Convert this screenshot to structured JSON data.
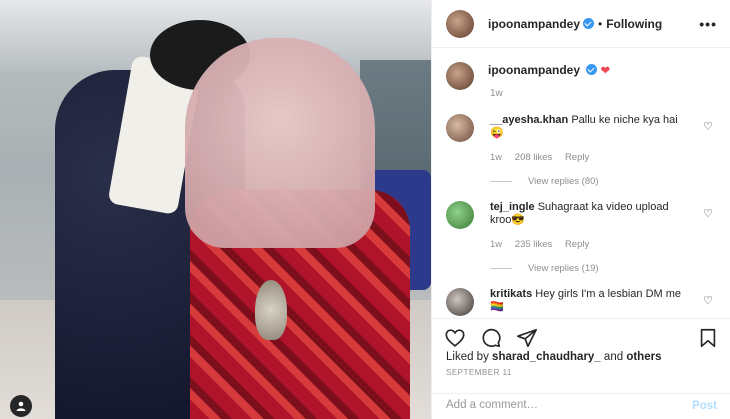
{
  "post": {
    "author": "ipoonampandey",
    "follow_label": "Following",
    "separator": "•",
    "more_label": "•••",
    "caption_heart": "❤",
    "caption_time": "1w",
    "likes_prefix": "Liked by",
    "liked_by_user": "sharad_chaudhary_",
    "likes_and": "and",
    "likes_others": "others",
    "date": "SEPTEMBER 11",
    "comment_placeholder": "Add a comment…",
    "post_label": "Post"
  },
  "comments": [
    {
      "user": "__ayesha.khan",
      "text": "Pallu ke niche kya hai😜",
      "time": "1w",
      "likes": "208 likes",
      "reply": "Reply",
      "view_replies": "View replies (80)"
    },
    {
      "user": "tej_ingle",
      "text": "Suhagraat ka video upload kroo😎",
      "time": "1w",
      "likes": "235 likes",
      "reply": "Reply",
      "view_replies": "View replies (19)"
    },
    {
      "user": "kritikats",
      "text": "Hey girls I'm a lesbian DM me 🏳️‍🌈"
    }
  ],
  "icons": {
    "like": "heart-outline-icon",
    "comment": "speech-bubble-icon",
    "share": "paper-plane-icon",
    "save": "bookmark-icon",
    "verified": "verified-badge-icon",
    "comment_like": "heart-outline-icon",
    "user": "user-icon"
  },
  "colors": {
    "verified": "#3897f0",
    "heart": "#ed4956",
    "muted": "#8e8e8e",
    "post_disabled": "#b2dffc"
  }
}
